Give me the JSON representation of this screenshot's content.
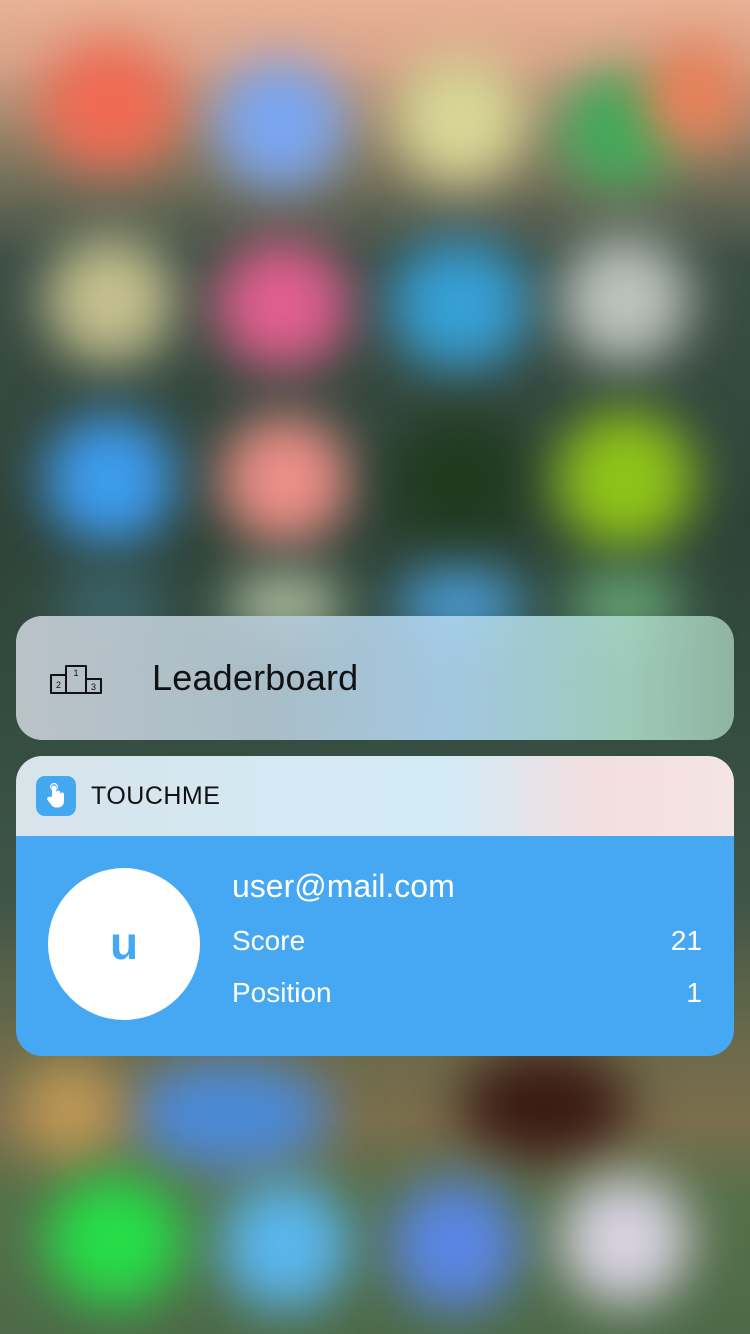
{
  "quick_action": {
    "icon": "podium-icon",
    "label": "Leaderboard"
  },
  "widget": {
    "app_icon": "touch-hand-icon",
    "app_name": "TOUCHME",
    "accent_color": "#46a8f2",
    "avatar_letter": "u",
    "email": "user@mail.com",
    "stats": [
      {
        "label": "Score",
        "value": "21"
      },
      {
        "label": "Position",
        "value": "1"
      }
    ]
  }
}
